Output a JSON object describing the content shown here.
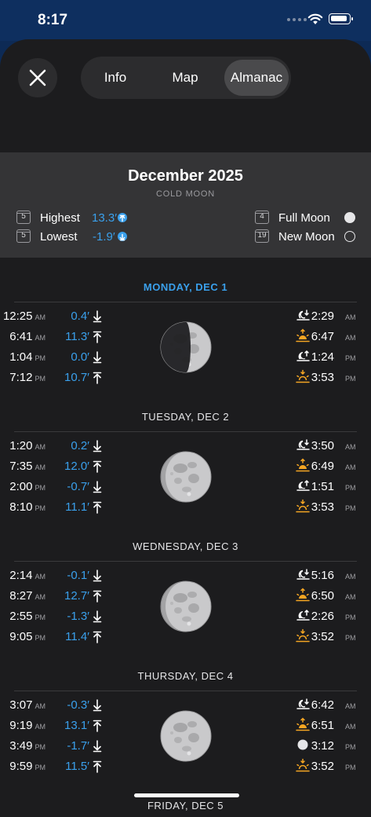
{
  "status": {
    "time": "8:17"
  },
  "tabs": {
    "info": "Info",
    "map": "Map",
    "almanac": "Almanac",
    "selected": "Almanac"
  },
  "month": {
    "title": "December 2025",
    "moon_name": "COLD MOON",
    "highest": {
      "label": "Highest",
      "day": "5",
      "value": "13.3′"
    },
    "lowest": {
      "label": "Lowest",
      "day": "5",
      "value": "-1.9′"
    },
    "full_moon": {
      "label": "Full Moon",
      "day": "4"
    },
    "new_moon": {
      "label": "New Moon",
      "day": "19"
    }
  },
  "days": [
    {
      "heading": "MONDAY, DEC 1",
      "today": true,
      "moon_phase": "first-quarter",
      "tides": [
        {
          "time": "12:25",
          "ampm": "AM",
          "height": "0.4′",
          "dir": "down"
        },
        {
          "time": "6:41",
          "ampm": "AM",
          "height": "11.3′",
          "dir": "up"
        },
        {
          "time": "1:04",
          "ampm": "PM",
          "height": "0.0′",
          "dir": "down"
        },
        {
          "time": "7:12",
          "ampm": "PM",
          "height": "10.7′",
          "dir": "up"
        }
      ],
      "astro": [
        {
          "icon": "moonset-icon",
          "time": "2:29",
          "ampm": "AM"
        },
        {
          "icon": "sunrise-icon",
          "time": "6:47",
          "ampm": "AM"
        },
        {
          "icon": "moonrise-icon",
          "time": "1:24",
          "ampm": "PM"
        },
        {
          "icon": "sunset-icon",
          "time": "3:53",
          "ampm": "PM"
        }
      ]
    },
    {
      "heading": "TUESDAY, DEC 2",
      "today": false,
      "moon_phase": "waxing-gibbous",
      "tides": [
        {
          "time": "1:20",
          "ampm": "AM",
          "height": "0.2′",
          "dir": "down"
        },
        {
          "time": "7:35",
          "ampm": "AM",
          "height": "12.0′",
          "dir": "up"
        },
        {
          "time": "2:00",
          "ampm": "PM",
          "height": "-0.7′",
          "dir": "down"
        },
        {
          "time": "8:10",
          "ampm": "PM",
          "height": "11.1′",
          "dir": "up"
        }
      ],
      "astro": [
        {
          "icon": "moonset-icon",
          "time": "3:50",
          "ampm": "AM"
        },
        {
          "icon": "sunrise-icon",
          "time": "6:49",
          "ampm": "AM"
        },
        {
          "icon": "moonrise-icon",
          "time": "1:51",
          "ampm": "PM"
        },
        {
          "icon": "sunset-icon",
          "time": "3:53",
          "ampm": "PM"
        }
      ]
    },
    {
      "heading": "WEDNESDAY, DEC 3",
      "today": false,
      "moon_phase": "waxing-gibbous",
      "tides": [
        {
          "time": "2:14",
          "ampm": "AM",
          "height": "-0.1′",
          "dir": "down"
        },
        {
          "time": "8:27",
          "ampm": "AM",
          "height": "12.7′",
          "dir": "up"
        },
        {
          "time": "2:55",
          "ampm": "PM",
          "height": "-1.3′",
          "dir": "down"
        },
        {
          "time": "9:05",
          "ampm": "PM",
          "height": "11.4′",
          "dir": "up"
        }
      ],
      "astro": [
        {
          "icon": "moonset-icon",
          "time": "5:16",
          "ampm": "AM"
        },
        {
          "icon": "sunrise-icon",
          "time": "6:50",
          "ampm": "AM"
        },
        {
          "icon": "moonrise-icon",
          "time": "2:26",
          "ampm": "PM"
        },
        {
          "icon": "sunset-icon",
          "time": "3:52",
          "ampm": "PM"
        }
      ]
    },
    {
      "heading": "THURSDAY, DEC 4",
      "today": false,
      "moon_phase": "full",
      "tides": [
        {
          "time": "3:07",
          "ampm": "AM",
          "height": "-0.3′",
          "dir": "down"
        },
        {
          "time": "9:19",
          "ampm": "AM",
          "height": "13.1′",
          "dir": "up"
        },
        {
          "time": "3:49",
          "ampm": "PM",
          "height": "-1.7′",
          "dir": "down"
        },
        {
          "time": "9:59",
          "ampm": "PM",
          "height": "11.5′",
          "dir": "up"
        }
      ],
      "astro": [
        {
          "icon": "moonset-icon",
          "time": "6:42",
          "ampm": "AM"
        },
        {
          "icon": "sunrise-icon",
          "time": "6:51",
          "ampm": "AM"
        },
        {
          "icon": "full-moon-icon",
          "time": "3:12",
          "ampm": "PM"
        },
        {
          "icon": "sunset-icon",
          "time": "3:52",
          "ampm": "PM"
        }
      ]
    },
    {
      "heading": "FRIDAY, DEC 5",
      "today": false,
      "moon_phase": "full",
      "tides": [],
      "astro": []
    }
  ]
}
